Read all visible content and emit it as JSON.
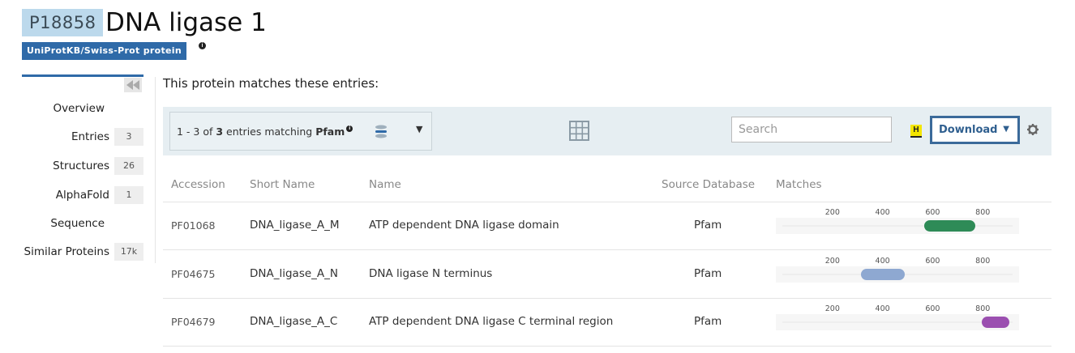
{
  "header": {
    "accession": "P18858",
    "title": "DNA ligase 1",
    "review_badge": "UniProtKB/Swiss-Prot protein"
  },
  "sidebar": {
    "items": [
      {
        "label": "Overview",
        "count": ""
      },
      {
        "label": "Entries",
        "count": "3"
      },
      {
        "label": "Structures",
        "count": "26"
      },
      {
        "label": "AlphaFold",
        "count": "1"
      },
      {
        "label": "Sequence",
        "count": ""
      },
      {
        "label": "Similar Proteins",
        "count": "17k"
      }
    ]
  },
  "main": {
    "intro": "This protein matches these entries:",
    "filter": {
      "prefix": "1 - 3 of ",
      "total": "3",
      "middle": " entries matching ",
      "database": "Pfam"
    },
    "search": {
      "placeholder": "Search"
    },
    "hotkey": "H",
    "download_label": "Download"
  },
  "table": {
    "columns": [
      "Accession",
      "Short Name",
      "Name",
      "Source Database",
      "Matches"
    ],
    "ticks": [
      "200",
      "400",
      "600",
      "800"
    ],
    "protein_length": 919,
    "rows": [
      {
        "accession": "PF01068",
        "short_name": "DNA_ligase_A_M",
        "name": "ATP dependent DNA ligase domain",
        "source": "Pfam",
        "match_start": 565,
        "match_end": 770,
        "color": "#2e8b57"
      },
      {
        "accession": "PF04675",
        "short_name": "DNA_ligase_A_N",
        "name": "DNA ligase N terminus",
        "source": "Pfam",
        "match_start": 313,
        "match_end": 490,
        "color": "#8ea8d1"
      },
      {
        "accession": "PF04679",
        "short_name": "DNA_ligase_A_C",
        "name": "ATP dependent DNA ligase C terminal region",
        "source": "Pfam",
        "match_start": 795,
        "match_end": 905,
        "color": "#9b4fb0"
      }
    ]
  },
  "colors": {
    "accent": "#2f6aa8",
    "badge_bg": "#bcd9ec",
    "toolbar_bg": "#e6eef2"
  }
}
